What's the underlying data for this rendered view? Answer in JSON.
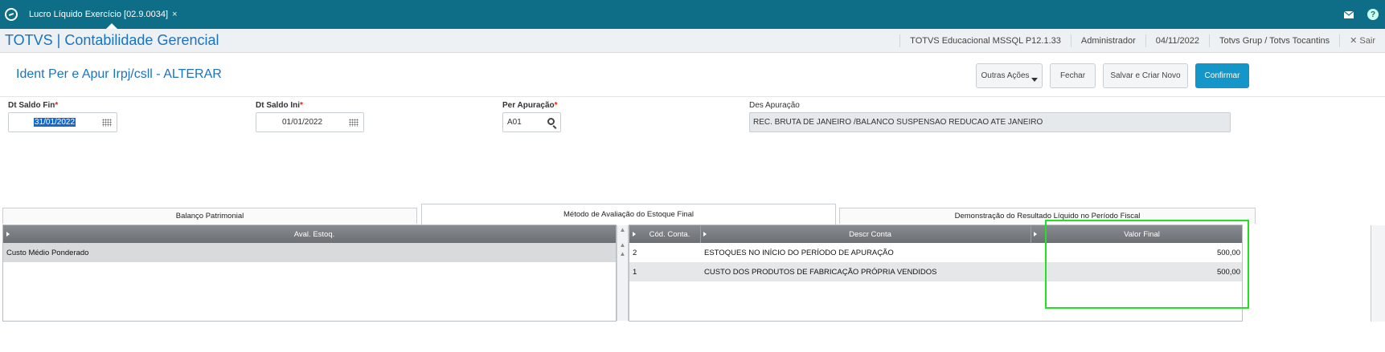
{
  "topbar": {
    "tab_title": "Lucro Líquido Exercício [02.9.0034]",
    "tab_close": "×",
    "mail_icon": "envelope-icon",
    "help_label": "?"
  },
  "header": {
    "app_title": "TOTVS | Contabilidade Gerencial",
    "environment": "TOTVS Educacional MSSQL P12.1.33",
    "user": "Administrador",
    "date": "04/11/2022",
    "company": "Totvs Grup / Totvs Tocantins",
    "exit_label": "✕ Sair"
  },
  "form": {
    "title": "Ident Per e Apur Irpj/csll - ALTERAR",
    "buttons": {
      "more_actions": "Outras Ações",
      "close": "Fechar",
      "save_new": "Salvar e Criar Novo",
      "confirm": "Confirmar"
    }
  },
  "fields": {
    "dt_saldo_fin": {
      "label": "Dt Saldo Fin",
      "value": "31/01/2022"
    },
    "dt_saldo_ini": {
      "label": "Dt Saldo Ini",
      "value": "01/01/2022"
    },
    "per_apuracao": {
      "label": "Per Apuração",
      "value": "A01"
    },
    "des_apuracao": {
      "label": "Des Apuração",
      "value": "REC. BRUTA DE JANEIRO /BALANCO SUSPENSAO REDUCAO ATE JANEIRO"
    },
    "required_mark": "*"
  },
  "tabs": {
    "balanco": "Balanço Patrimonial",
    "metodo": "Método de Avaliação do Estoque Final",
    "demonstracao": "Demonstração do Resultado Líquido no Período Fiscal"
  },
  "left_grid": {
    "header": "Aval. Estoq.",
    "rows": [
      "Custo Médio Ponderado"
    ]
  },
  "right_grid": {
    "headers": {
      "cod": "Cód. Conta.",
      "descr": "Descr Conta",
      "valor": "Valor Final"
    },
    "rows": [
      {
        "cod": "2",
        "descr": "ESTOQUES NO INÍCIO DO PERÍODO DE APURAÇÃO",
        "valor": "500,00"
      },
      {
        "cod": "1",
        "descr": "CUSTO DOS PRODUTOS DE FABRICAÇÃO PRÓPRIA VENDIDOS",
        "valor": "500,00"
      }
    ]
  },
  "colors": {
    "topbar": "#0e6e87",
    "accent_text": "#1a73c1",
    "confirm_button": "#1497c8",
    "highlight_box": "#22e022"
  }
}
